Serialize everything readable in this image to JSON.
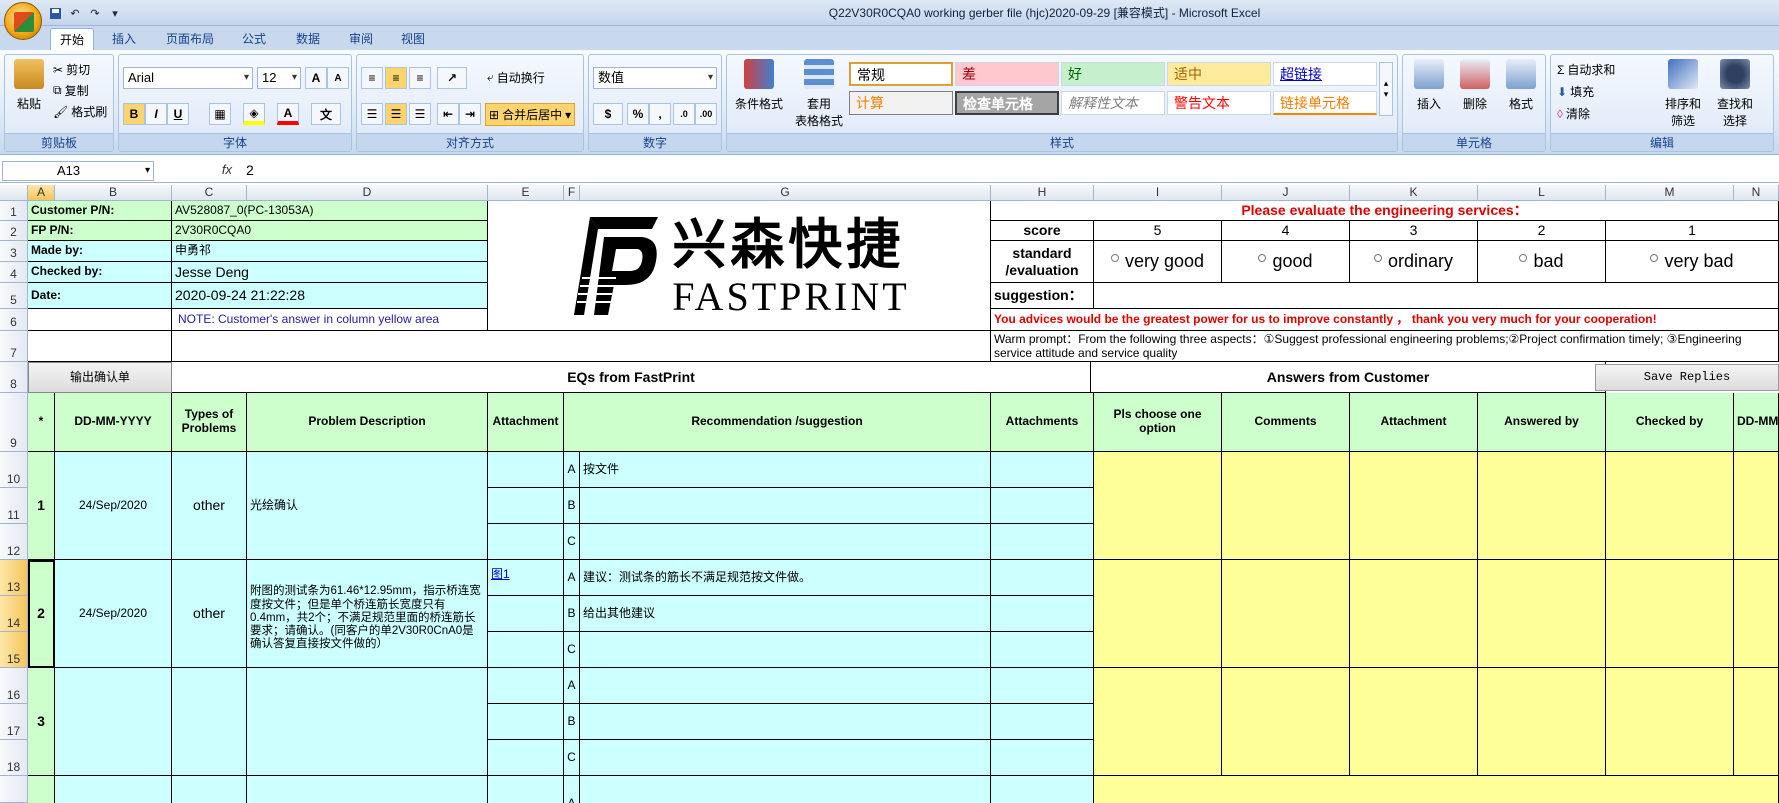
{
  "window": {
    "title": "Q22V30R0CQA0 working gerber file (hjc)2020-09-29  [兼容模式] - Microsoft Excel"
  },
  "ribbon": {
    "tabs": [
      "开始",
      "插入",
      "页面布局",
      "公式",
      "数据",
      "审阅",
      "视图"
    ],
    "clipboard": {
      "paste": "粘贴",
      "cut": "剪切",
      "copy": "复制",
      "format_painter": "格式刷",
      "label": "剪贴板"
    },
    "font": {
      "name": "Arial",
      "size": "12",
      "bold": "B",
      "italic": "I",
      "underline": "U",
      "label": "字体"
    },
    "alignment": {
      "wrap": "自动换行",
      "merge": "合并后居中",
      "label": "对齐方式"
    },
    "number": {
      "format": "数值",
      "percent": "%",
      "comma": ",",
      "label": "数字"
    },
    "styles": {
      "conditional": "条件格式",
      "table": "套用\n表格格式",
      "cells": [
        "常规",
        "差",
        "好",
        "适中",
        "超链接",
        "计算",
        "检查单元格",
        "解释性文本",
        "警告文本",
        "链接单元格"
      ],
      "label": "样式"
    },
    "cells": {
      "insert": "插入",
      "delete": "删除",
      "format": "格式",
      "label": "单元格"
    },
    "editing": {
      "autosum": "自动求和",
      "fill": "填充",
      "clear": "清除",
      "sort": "排序和\n筛选",
      "find": "查找和\n选择",
      "label": "编辑"
    }
  },
  "formula_bar": {
    "name_box": "A13",
    "fx": "fx",
    "value": "2"
  },
  "columns": [
    "A",
    "B",
    "C",
    "D",
    "E",
    "F",
    "G",
    "H",
    "I",
    "J",
    "K",
    "L",
    "M",
    "N"
  ],
  "rows": [
    "1",
    "2",
    "3",
    "4",
    "5",
    "6",
    "7",
    "8",
    "9",
    "10",
    "11",
    "12",
    "13",
    "14",
    "15",
    "16",
    "17",
    "18"
  ],
  "info": {
    "customer_pn_label": "Customer P/N:",
    "customer_pn": "AV528087_0(PC-13053A)",
    "fp_pn_label": "FP P/N:",
    "fp_pn": "2V30R0CQA0",
    "made_by_label": "Made by:",
    "made_by": "申勇祁",
    "checked_by_label": "Checked by:",
    "checked_by": "Jesse Deng",
    "date_label": "Date:",
    "date": "2020-09-24 21:22:28",
    "note": "NOTE: Customer's  answer in column yellow area"
  },
  "logo": {
    "chinese": "兴森快捷",
    "english": "FASTPRINT"
  },
  "evaluation": {
    "header": "Please evaluate the engineering services：",
    "score_label": "score",
    "scores": [
      "5",
      "4",
      "3",
      "2",
      "1"
    ],
    "standard_label": "standard\n/evaluation",
    "options": [
      "very good",
      "good",
      "ordinary",
      "bad",
      "very bad"
    ],
    "suggestion_label": "suggestion：",
    "thanks": "You advices would be the greatest power for us to improve constantly ， thank you very much for your cooperation!",
    "warm_prompt": "Warm prompt：From the following three aspects：①Suggest professional engineering problems;②Project confirmation timely; ③Engineering service attitude and service quality"
  },
  "table": {
    "output_button": "输出确认单",
    "eq_header": "EQs from FastPrint",
    "answers_header": "Answers from Customer",
    "save_button": "Save Replies",
    "headers": [
      "*",
      "DD-MM-YYYY",
      "Types of Problems",
      "Problem Description",
      "Attachment",
      "Recommendation /suggestion",
      "Attachments",
      "Pls choose one option",
      "Comments",
      "Attachment",
      "Answered by",
      "Checked by",
      "DD-MM"
    ],
    "eqs": [
      {
        "no": "1",
        "date": "24/Sep/2020",
        "type": "other",
        "description": "光绘确认",
        "attachment": "",
        "options": [
          {
            "letter": "A",
            "text": "按文件"
          },
          {
            "letter": "B",
            "text": ""
          },
          {
            "letter": "C",
            "text": ""
          }
        ]
      },
      {
        "no": "2",
        "date": "24/Sep/2020",
        "type": "other",
        "description": "附图的测试条为61.46*12.95mm，指示桥连宽度按文件；但是单个桥连筋长宽度只有0.4mm，共2个；不满足规范里面的桥连筋长要求；请确认。(同客户的单2V30R0CnA0是确认答复直接按文件做的）",
        "attachment": "图1",
        "options": [
          {
            "letter": "A",
            "text": "建议：测试条的筋长不满足规范按文件做。"
          },
          {
            "letter": "B",
            "text": "给出其他建议"
          },
          {
            "letter": "C",
            "text": ""
          }
        ]
      },
      {
        "no": "3",
        "date": "",
        "type": "",
        "description": "",
        "attachment": "",
        "options": [
          {
            "letter": "A",
            "text": ""
          },
          {
            "letter": "B",
            "text": ""
          },
          {
            "letter": "C",
            "text": ""
          }
        ]
      }
    ],
    "next_letter": "A"
  },
  "colors": {
    "green": "#ccffcc",
    "cyan": "#ccffff",
    "yellow": "#ffff99",
    "red": "#e00000",
    "blue": "#1f1fa0"
  }
}
